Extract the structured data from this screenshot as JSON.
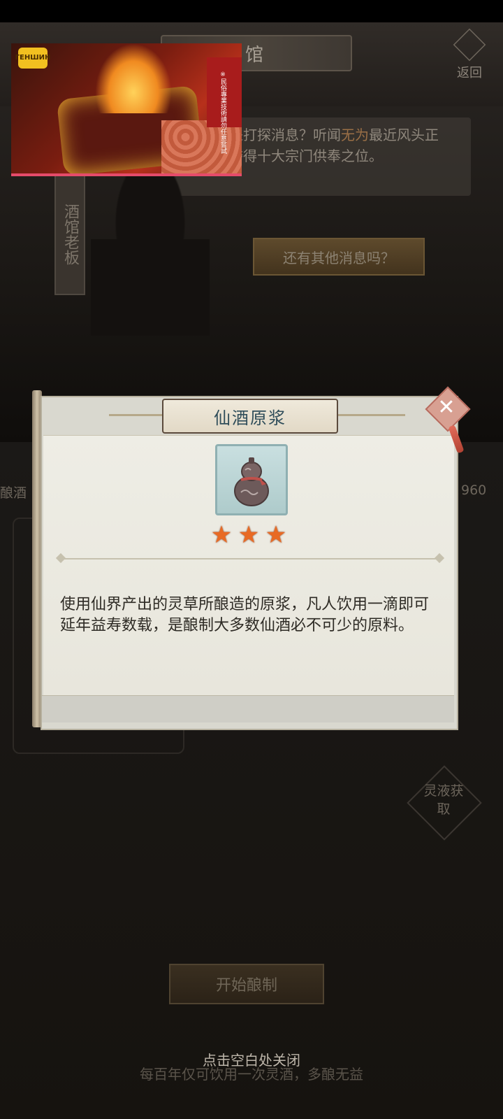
{
  "background": {
    "title": "馆",
    "back_label": "返回",
    "dialog_text_1": "饮酒还是来打探消息？听闻",
    "dialog_highlight": "无为",
    "dialog_text_2": "最近风头正盛，一举夺得十大宗门供奉之位。",
    "npc_name": "酒馆老板",
    "more_news_button": "还有其他消息吗？",
    "side_left_label": "酿酒",
    "side_right_value": "960",
    "get_button_label": "灵液获取",
    "start_button": "开始酿制",
    "close_hint": "点击空白处关闭",
    "footer_note": "每百年仅可饮用一次灵酒，多酿无益"
  },
  "video_overlay": {
    "badge": "ГЕНШИН",
    "note": "※民俗專業技術請勿任意嘗試"
  },
  "popup": {
    "title": "仙酒原浆",
    "stars": 3,
    "description": "使用仙界产出的灵草所酿造的原浆，凡人饮用一滴即可延年益寿数载，是酿制大多数仙酒必不可少的原料。",
    "close_icon": "close-x-icon"
  },
  "colors": {
    "popup_bg": "#e8e6dc",
    "title_color": "#2f4d5a",
    "star_color": "#e86a24"
  }
}
